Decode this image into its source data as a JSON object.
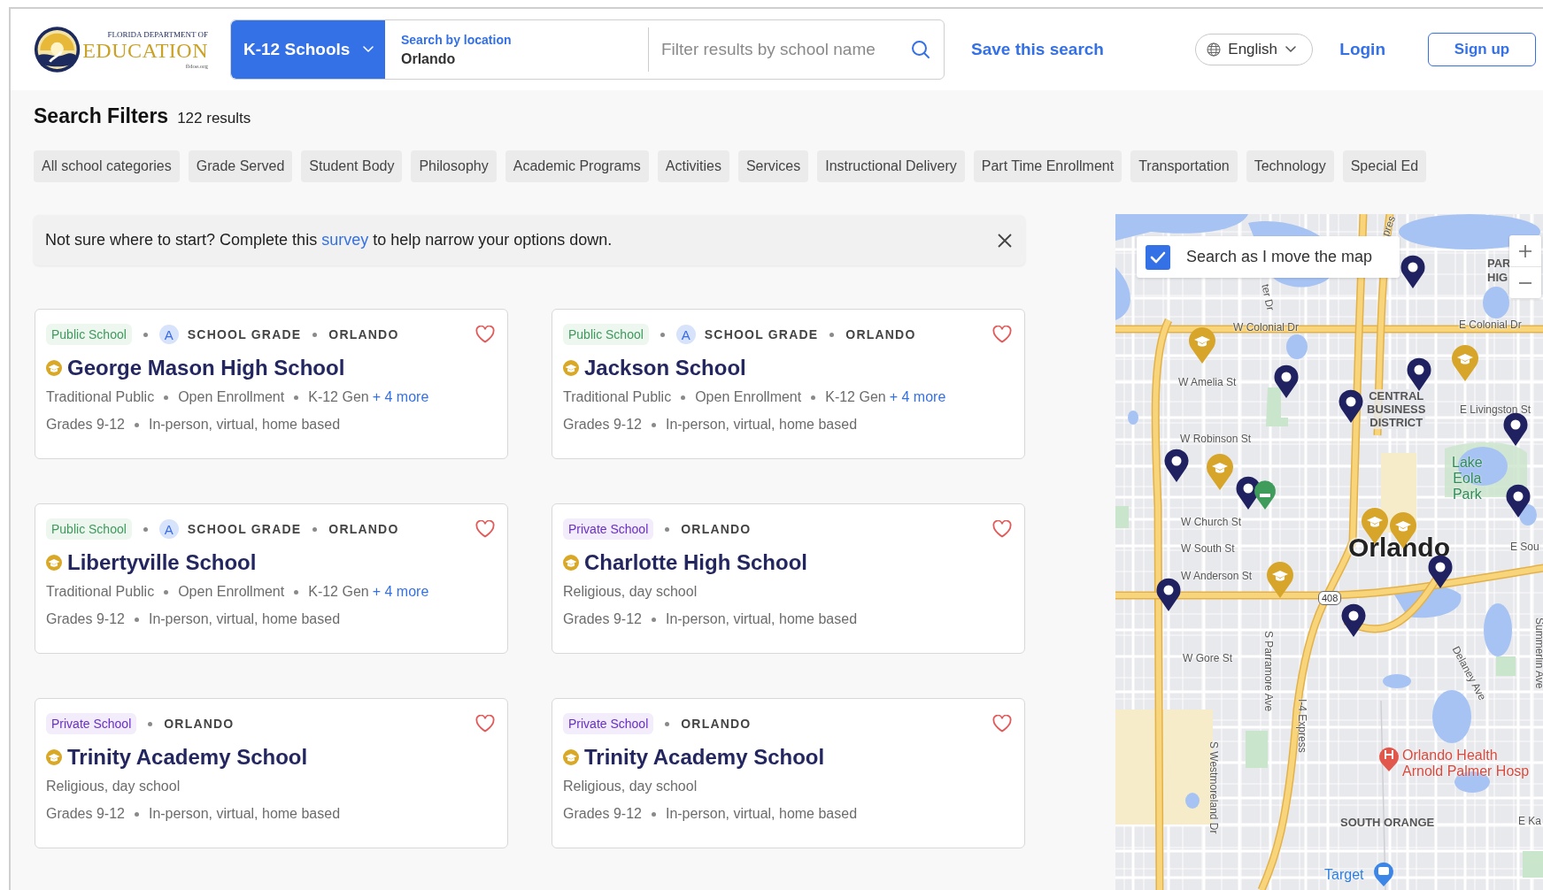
{
  "header": {
    "logo": {
      "line1": "FLORIDA DEPARTMENT OF",
      "line2": "EDUCATION",
      "line3": "fldoe.org"
    },
    "category_button": "K-12 Schools",
    "location": {
      "label": "Search by location",
      "value": "Orlando"
    },
    "school_search": {
      "placeholder": "Filter results by school name"
    },
    "save_search": "Save this search",
    "language": "English",
    "login": "Login",
    "signup": "Sign up"
  },
  "filters": {
    "title": "Search Filters",
    "count": "122 results",
    "chips": [
      "All school categories",
      "Grade Served",
      "Student Body",
      "Philosophy",
      "Academic Programs",
      "Activities",
      "Services",
      "Instructional Delivery",
      "Part Time Enrollment",
      "Transportation",
      "Technology",
      "Special Ed"
    ]
  },
  "banner": {
    "before": "Not sure where to start? Complete this",
    "link": "survey",
    "after": "to help narrow your options down."
  },
  "cards": [
    {
      "type": {
        "label": "Public School",
        "kind": "public"
      },
      "grade": "A",
      "grade_label": "SCHOOL GRADE",
      "city": "ORLANDO",
      "name": "George Mason High School",
      "details": [
        "Traditional Public",
        "Open Enrollment",
        "K-12 Gen"
      ],
      "more": "+ 4 more",
      "grades": "Grades 9-12",
      "delivery": "In-person, virtual, home based",
      "favorited": false
    },
    {
      "type": {
        "label": "Public School",
        "kind": "public"
      },
      "grade": "A",
      "grade_label": "SCHOOL GRADE",
      "city": "ORLANDO",
      "name": "Jackson School",
      "details": [
        "Traditional Public",
        "Open Enrollment",
        "K-12 Gen"
      ],
      "more": "+ 4 more",
      "grades": "Grades 9-12",
      "delivery": "In-person, virtual, home based",
      "favorited": false
    },
    {
      "type": {
        "label": "Public School",
        "kind": "public"
      },
      "grade": "A",
      "grade_label": "SCHOOL GRADE",
      "city": "ORLANDO",
      "name": "Libertyville School",
      "details": [
        "Traditional Public",
        "Open Enrollment",
        "K-12 Gen"
      ],
      "more": "+ 4 more",
      "grades": "Grades 9-12",
      "delivery": "In-person, virtual, home based",
      "favorited": false
    },
    {
      "type": {
        "label": "Private School",
        "kind": "private"
      },
      "city": "ORLANDO",
      "name": "Charlotte High School",
      "details": [
        "Religious, day school"
      ],
      "grades": "Grades 9-12",
      "delivery": "In-person, virtual, home based",
      "favorited": false
    },
    {
      "type": {
        "label": "Private School",
        "kind": "private"
      },
      "city": "ORLANDO",
      "name": "Trinity Academy School",
      "details": [
        "Religious, day school"
      ],
      "grades": "Grades 9-12",
      "delivery": "In-person, virtual, home based",
      "favorited": false
    },
    {
      "type": {
        "label": "Private School",
        "kind": "private"
      },
      "city": "ORLANDO",
      "name": "Trinity Academy School",
      "details": [
        "Religious, day school"
      ],
      "grades": "Grades 9-12",
      "delivery": "In-person, virtual, home based",
      "favorited": false
    }
  ],
  "map": {
    "search_as_move": {
      "label": "Search as I move the map",
      "checked": true
    },
    "labels": [
      {
        "text": "pres",
        "kind": "street"
      },
      {
        "text": "PAR",
        "kind": "area"
      },
      {
        "text": "HIG",
        "kind": "area"
      },
      {
        "text": "ter Dr",
        "kind": "street"
      },
      {
        "text": "W Colonial Dr",
        "kind": "street"
      },
      {
        "text": "E Colonial Dr",
        "kind": "street"
      },
      {
        "text": "W Amelia St",
        "kind": "street"
      },
      {
        "text": "CENTRAL BUSINESS DISTRICT",
        "kind": "district"
      },
      {
        "text": "E Livingston St",
        "kind": "street"
      },
      {
        "text": "W Robinson St",
        "kind": "street"
      },
      {
        "text": "Lake Eola Park",
        "kind": "park"
      },
      {
        "text": "W Church St",
        "kind": "street"
      },
      {
        "text": "W South St",
        "kind": "street"
      },
      {
        "text": "Orlando",
        "kind": "city"
      },
      {
        "text": "E Sou",
        "kind": "street"
      },
      {
        "text": "W Anderson St",
        "kind": "street"
      },
      {
        "text": "408",
        "kind": "shield"
      },
      {
        "text": "W Gore St",
        "kind": "street"
      },
      {
        "text": "S Parramore Ave",
        "kind": "street"
      },
      {
        "text": "Delaney Ave",
        "kind": "street"
      },
      {
        "text": "Summerlin Ave",
        "kind": "street"
      },
      {
        "text": "I-4 Express",
        "kind": "street"
      },
      {
        "text": "S Westmoreland Dr",
        "kind": "street"
      },
      {
        "text": "Orlando Health",
        "kind": "hospital"
      },
      {
        "text": "Arnold Palmer Hosp",
        "kind": "hospital"
      },
      {
        "text": "SOUTH ORANGE",
        "kind": "area"
      },
      {
        "text": "E Ka",
        "kind": "street"
      },
      {
        "text": "Target",
        "kind": "store"
      }
    ]
  }
}
